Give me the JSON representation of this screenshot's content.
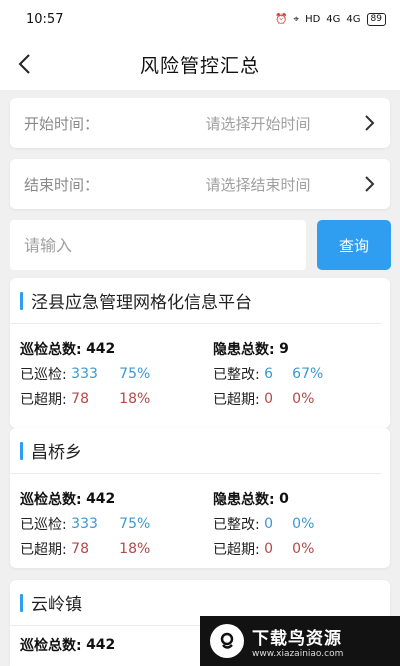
{
  "status_bar": {
    "time": "10:57",
    "network": "HD",
    "signal1": "4G",
    "signal2": "4G",
    "battery": "89"
  },
  "header": {
    "title": "风险管控汇总"
  },
  "filters": {
    "start": {
      "label": "开始时间：",
      "placeholder": "请选择开始时间"
    },
    "end": {
      "label": "结束时间：",
      "placeholder": "请选择结束时间"
    }
  },
  "search": {
    "placeholder": "请输入",
    "button_label": "查询"
  },
  "cards": [
    {
      "title": "泾县应急管理网格化信息平台",
      "patrol_total_label": "巡检总数:",
      "patrol_total": "442",
      "patrolled_label": "已巡检:",
      "patrolled": "333",
      "patrolled_pct": "75%",
      "overdue_label": "已超期:",
      "overdue": "78",
      "overdue_pct": "18%",
      "hazard_total_label": "隐患总数:",
      "hazard_total": "9",
      "rectified_label": "已整改:",
      "rectified": "6",
      "rectified_pct": "67%",
      "hazard_overdue_label": "已超期:",
      "hazard_overdue": "0",
      "hazard_overdue_pct": "0%"
    },
    {
      "title": "昌桥乡",
      "patrol_total_label": "巡检总数:",
      "patrol_total": "442",
      "patrolled_label": "已巡检:",
      "patrolled": "333",
      "patrolled_pct": "75%",
      "overdue_label": "已超期:",
      "overdue": "78",
      "overdue_pct": "18%",
      "hazard_total_label": "隐患总数:",
      "hazard_total": "0",
      "rectified_label": "已整改:",
      "rectified": "0",
      "rectified_pct": "0%",
      "hazard_overdue_label": "已超期:",
      "hazard_overdue": "0",
      "hazard_overdue_pct": "0%"
    },
    {
      "title": "云岭镇",
      "patrol_total_label": "巡检总数:",
      "patrol_total": "442"
    }
  ],
  "watermark": {
    "title": "下载鸟资源",
    "url": "www.xiazainiao.com"
  },
  "colors": {
    "accent": "#2f9ef0",
    "blue_text": "#3d98d0",
    "red_text": "#b24a4a",
    "background": "#f0f0f0"
  }
}
